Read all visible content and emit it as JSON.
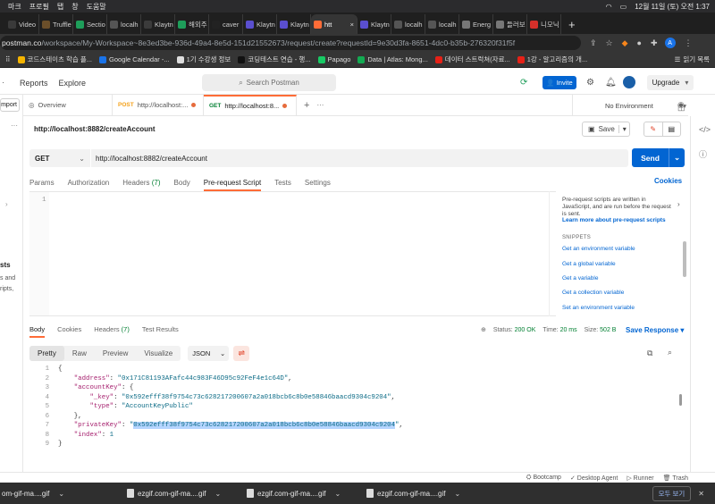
{
  "menubar": {
    "items": [
      "마크",
      "프로필",
      "탭",
      "창",
      "도움말"
    ],
    "clock": "12월 11일 (토) 오전 1:37"
  },
  "browser_tabs": [
    {
      "label": "Video",
      "color": "#3a3a3a"
    },
    {
      "label": "Truffle",
      "color": "#6b4f2a"
    },
    {
      "label": "Sectio",
      "color": "#1e9e5a"
    },
    {
      "label": "localh",
      "color": "#555"
    },
    {
      "label": "Klaytn",
      "color": "#3b3b3b"
    },
    {
      "label": "해외주",
      "color": "#1e9e5a"
    },
    {
      "label": "caver",
      "color": "#222"
    },
    {
      "label": "Klaytn",
      "color": "#5a4fcf"
    },
    {
      "label": "Klaytn",
      "color": "#5a4fcf"
    },
    {
      "label": "htt",
      "color": "#ff6c37",
      "active": true
    },
    {
      "label": "Klaytn",
      "color": "#5a4fcf"
    },
    {
      "label": "localh",
      "color": "#555"
    },
    {
      "label": "localh",
      "color": "#555"
    },
    {
      "label": "Energ",
      "color": "#777"
    },
    {
      "label": "들러보",
      "color": "#777"
    },
    {
      "label": "니모닉",
      "color": "#d4302a"
    }
  ],
  "address": {
    "host": "postman.co",
    "path": "/workspace/My-Workspace~8e3ed3be-936d-49a4-8e5d-151d21552673/request/create?requestId=9e30d3fa-8651-4dc0-b35b-276320f31f5f",
    "profile_initial": "A"
  },
  "bookmarks": [
    {
      "label": "코드스테이츠 학습 플...",
      "color": "#f5b400"
    },
    {
      "label": "Google Calendar -...",
      "color": "#1a73e8"
    },
    {
      "label": "1기 수강생 정보",
      "color": "#ddd"
    },
    {
      "label": "코딩테스트 연습 - 행...",
      "color": "#222"
    },
    {
      "label": "Papago",
      "color": "#18c964"
    },
    {
      "label": "Data | Atlas: Mong...",
      "color": "#13aa52"
    },
    {
      "label": "데이터 스트럭쳐(자료...",
      "color": "#e62117"
    },
    {
      "label": "1강 - 알고리즘의 개...",
      "color": "#e62117"
    }
  ],
  "reading_list": "읽기 목록",
  "postman": {
    "nav": [
      "Reports",
      "Explore"
    ],
    "search_placeholder": "Search Postman",
    "invite_label": "Invite",
    "upgrade_label": "Upgrade",
    "import_label": "mport",
    "sidebar_snippets": [
      "sts",
      "s and",
      "ripts,"
    ]
  },
  "request_tabs": [
    {
      "label": "Overview",
      "method": ""
    },
    {
      "label": "http://localhost:...",
      "method": "POST"
    },
    {
      "label": "http://localhost:8...",
      "method": "GET",
      "active": true
    }
  ],
  "environment": "No Environment",
  "request": {
    "name": "http://localhost:8882/createAccount",
    "method": "GET",
    "url": "http://localhost:8882/createAccount",
    "save_label": "Save",
    "send_label": "Send",
    "subtabs": [
      {
        "label": "Params"
      },
      {
        "label": "Authorization"
      },
      {
        "label": "Headers",
        "count": "(7)"
      },
      {
        "label": "Body"
      },
      {
        "label": "Pre-request Script",
        "active": true
      },
      {
        "label": "Tests"
      },
      {
        "label": "Settings"
      }
    ],
    "cookies_label": "Cookies",
    "editor_line": "1"
  },
  "snippets": {
    "description": "Pre-request scripts are written in JavaScript, and are run before the request is sent.",
    "learn_more": "Learn more about pre-request scripts",
    "heading": "SNIPPETS",
    "items": [
      "Get an environment variable",
      "Get a global variable",
      "Get a variable",
      "Get a collection variable",
      "Set an environment variable"
    ]
  },
  "response": {
    "tabs": [
      {
        "label": "Body",
        "active": true
      },
      {
        "label": "Cookies"
      },
      {
        "label": "Headers",
        "count": "(7)"
      },
      {
        "label": "Test Results"
      }
    ],
    "status_label": "Status:",
    "status_value": "200 OK",
    "time_label": "Time:",
    "time_value": "20 ms",
    "size_label": "Size:",
    "size_value": "502 B",
    "save_response": "Save Response",
    "formats": [
      "Pretty",
      "Raw",
      "Preview",
      "Visualize"
    ],
    "active_format": "Pretty",
    "language": "JSON",
    "json_lines": [
      {
        "n": "1",
        "parts": [
          {
            "t": "{",
            "c": "p"
          }
        ]
      },
      {
        "n": "2",
        "parts": [
          {
            "t": "    ",
            "c": "p"
          },
          {
            "t": "\"address\"",
            "c": "k"
          },
          {
            "t": ": ",
            "c": "p"
          },
          {
            "t": "\"0x171C81193AFafc44c983F46D95c92FeF4e1c64D\"",
            "c": "s"
          },
          {
            "t": ",",
            "c": "p"
          }
        ]
      },
      {
        "n": "3",
        "parts": [
          {
            "t": "    ",
            "c": "p"
          },
          {
            "t": "\"accountKey\"",
            "c": "k"
          },
          {
            "t": ": {",
            "c": "p"
          }
        ]
      },
      {
        "n": "4",
        "parts": [
          {
            "t": "        ",
            "c": "p"
          },
          {
            "t": "\"_key\"",
            "c": "k"
          },
          {
            "t": ": ",
            "c": "p"
          },
          {
            "t": "\"0x592efff38f9754c73c628217200607a2a018bcb6c8b0e58846baacd9304c9204\"",
            "c": "s"
          },
          {
            "t": ",",
            "c": "p"
          }
        ]
      },
      {
        "n": "5",
        "parts": [
          {
            "t": "        ",
            "c": "p"
          },
          {
            "t": "\"type\"",
            "c": "k"
          },
          {
            "t": ": ",
            "c": "p"
          },
          {
            "t": "\"AccountKeyPublic\"",
            "c": "s"
          }
        ]
      },
      {
        "n": "6",
        "parts": [
          {
            "t": "    },",
            "c": "p"
          }
        ]
      },
      {
        "n": "7",
        "parts": [
          {
            "t": "    ",
            "c": "p"
          },
          {
            "t": "\"privateKey\"",
            "c": "k"
          },
          {
            "t": ": ",
            "c": "p"
          },
          {
            "t": "\"",
            "c": "s"
          },
          {
            "t": "0x592efff38f9754c73c628217200607a2a018bcb6c8b0e58846baacd9304c9204",
            "c": "s hl"
          },
          {
            "t": "\"",
            "c": "s"
          },
          {
            "t": ",",
            "c": "p"
          }
        ]
      },
      {
        "n": "8",
        "parts": [
          {
            "t": "    ",
            "c": "p"
          },
          {
            "t": "\"index\"",
            "c": "k"
          },
          {
            "t": ": ",
            "c": "p"
          },
          {
            "t": "1",
            "c": "s"
          }
        ]
      },
      {
        "n": "9",
        "parts": [
          {
            "t": "}",
            "c": "p"
          }
        ]
      }
    ]
  },
  "statusbar": [
    "Bootcamp",
    "Desktop Agent",
    "Runner",
    "Trash"
  ],
  "downloads": {
    "items": [
      "om-gif-ma....gif",
      "ezgif.com-gif-ma....gif",
      "ezgif.com-gif-ma....gif",
      "ezgif.com-gif-ma....gif"
    ],
    "show_all": "모두 보기"
  }
}
